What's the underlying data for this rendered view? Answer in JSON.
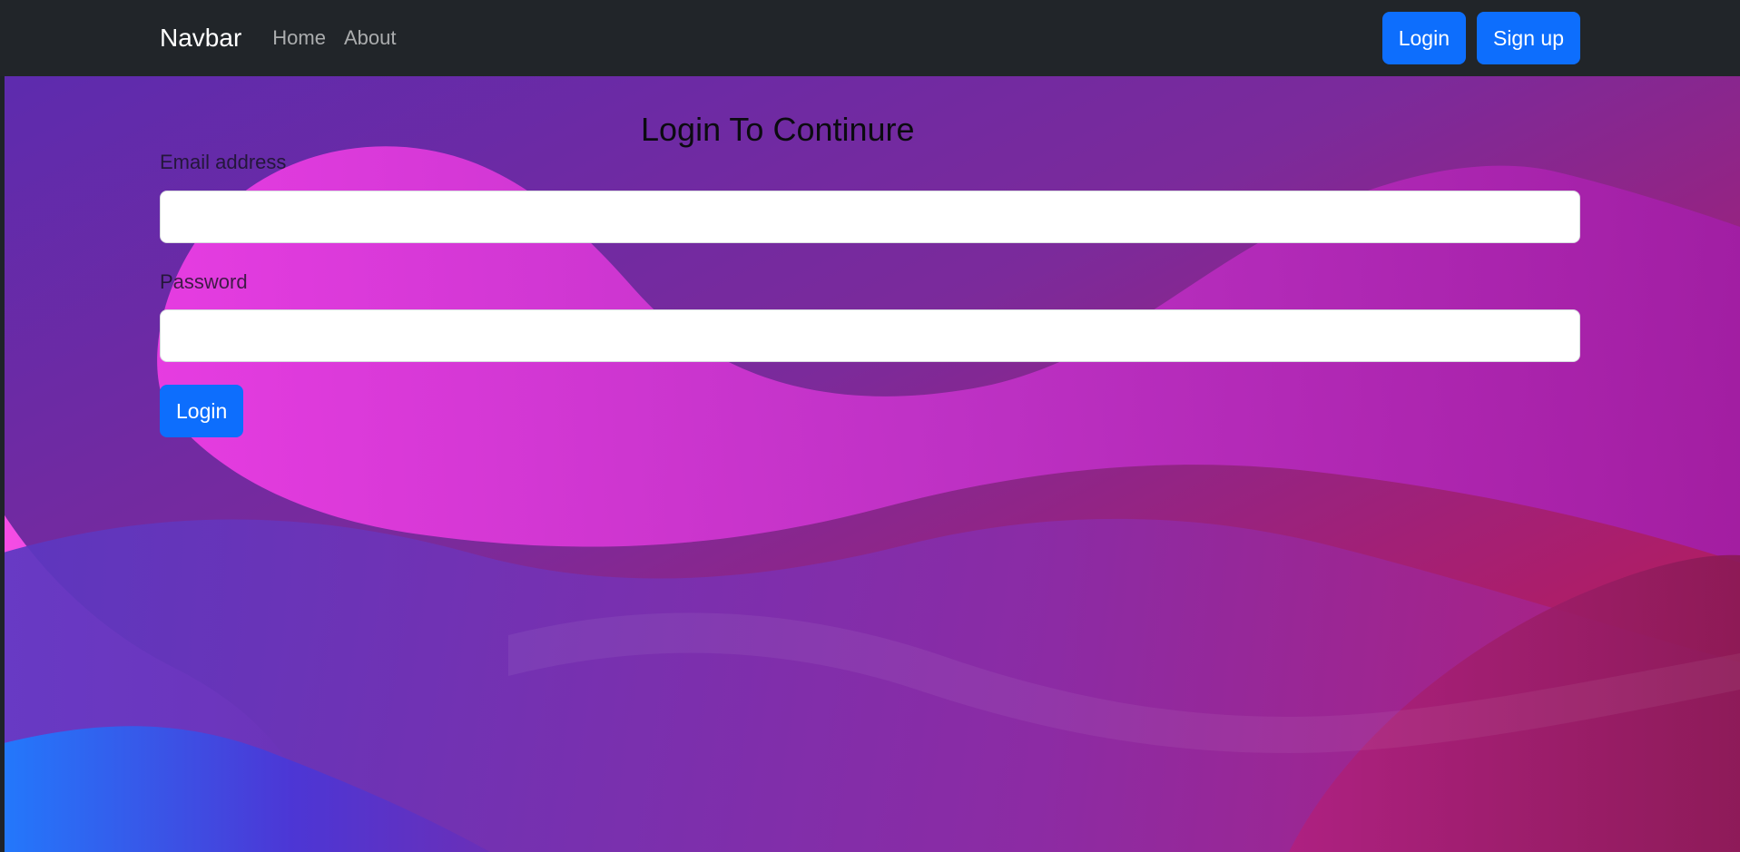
{
  "navbar": {
    "brand": "Navbar",
    "links": [
      {
        "label": "Home"
      },
      {
        "label": "About"
      }
    ],
    "buttons": [
      {
        "label": "Login"
      },
      {
        "label": "Sign up"
      }
    ]
  },
  "login_form": {
    "title": "Login To Continure",
    "email": {
      "label": "Email address",
      "value": "",
      "placeholder": ""
    },
    "password": {
      "label": "Password",
      "value": "",
      "placeholder": ""
    },
    "submit_label": "Login"
  },
  "colors": {
    "navbar_bg": "#212529",
    "primary_button": "#0d6efd",
    "page_gradient_start": "#5a2bb0",
    "page_gradient_end": "#c41a47"
  },
  "icons": []
}
